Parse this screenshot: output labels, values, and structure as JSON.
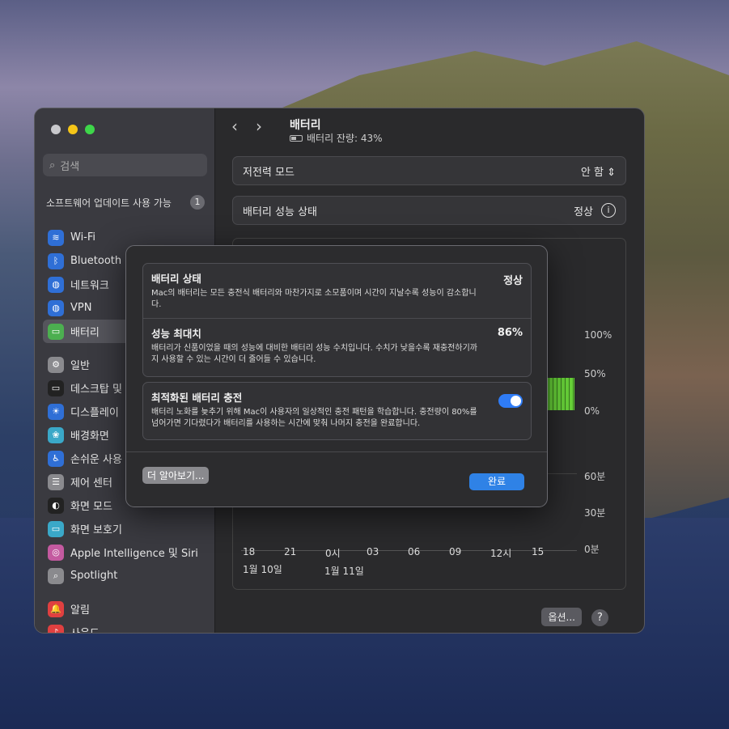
{
  "window": {
    "title": "배터리",
    "subtitle": "배터리 잔량: 43%",
    "battery_level_percent": 43
  },
  "sidebar": {
    "search_placeholder": "검색",
    "update_label": "소프트웨어 업데이트 사용 가능",
    "update_count": "1",
    "items": [
      {
        "label": "Wi-Fi",
        "icon": "wifi-icon",
        "color": "#2f6fd6",
        "glyph": "≋"
      },
      {
        "label": "Bluetooth",
        "icon": "bluetooth-icon",
        "color": "#2f6fd6",
        "glyph": "ᛒ"
      },
      {
        "label": "네트워크",
        "icon": "globe-icon",
        "color": "#2f6fd6",
        "glyph": "◍"
      },
      {
        "label": "VPN",
        "icon": "vpn-globe-icon",
        "color": "#2f6fd6",
        "glyph": "◍"
      },
      {
        "label": "배터리",
        "icon": "battery-icon",
        "color": "#4caf50",
        "glyph": "▭",
        "selected": true
      },
      {
        "label": "일반",
        "icon": "gear-icon",
        "color": "#8a8a8e",
        "glyph": "⚙"
      },
      {
        "label": "데스크탑 및 Dock",
        "icon": "dock-icon",
        "color": "#222",
        "glyph": "▭"
      },
      {
        "label": "디스플레이",
        "icon": "display-icon",
        "color": "#2f6fd6",
        "glyph": "☀"
      },
      {
        "label": "배경화면",
        "icon": "wallpaper-icon",
        "color": "#3aa8c8",
        "glyph": "❀"
      },
      {
        "label": "손쉬운 사용",
        "icon": "accessibility-icon",
        "color": "#2f6fd6",
        "glyph": "♿"
      },
      {
        "label": "제어 센터",
        "icon": "control-center-icon",
        "color": "#8a8a8e",
        "glyph": "☰"
      },
      {
        "label": "화면 모드",
        "icon": "appearance-icon",
        "color": "#222",
        "glyph": "◐"
      },
      {
        "label": "화면 보호기",
        "icon": "screensaver-icon",
        "color": "#3aa8c8",
        "glyph": "▭"
      },
      {
        "label": "Apple Intelligence 및 Siri",
        "icon": "siri-icon",
        "color": "#c45aa0",
        "glyph": "◎"
      },
      {
        "label": "Spotlight",
        "icon": "spotlight-icon",
        "color": "#8a8a8e",
        "glyph": "⌕"
      },
      {
        "label": "알림",
        "icon": "bell-icon",
        "color": "#e04040",
        "glyph": "🔔"
      },
      {
        "label": "사운드",
        "icon": "sound-icon",
        "color": "#e04040",
        "glyph": "♪"
      }
    ]
  },
  "main": {
    "low_power_label": "저전력 모드",
    "low_power_value": "안 함",
    "health_label": "배터리 성능 상태",
    "health_value": "정상",
    "level_axis": [
      "100%",
      "50%",
      "0%"
    ],
    "usage_axis": [
      "60분",
      "30분",
      "0분"
    ],
    "x_ticks": [
      "18",
      "21",
      "0시",
      "03",
      "06",
      "09",
      "12시",
      "15"
    ],
    "dates": [
      "1월 10일",
      "1월 11일"
    ],
    "options_label": "옵션...",
    "help_label": "?"
  },
  "dialog": {
    "status_title": "배터리 상태",
    "status_value": "정상",
    "status_desc": "Mac의 배터리는 모든 충전식 배터리와 마찬가지로 소모품이며 시간이 지날수록 성능이 감소합니다.",
    "capacity_title": "성능 최대치",
    "capacity_value": "86%",
    "capacity_desc": "배터리가 신품이었을 때의 성능에 대비한 배터리 성능 수치입니다. 수치가 낮을수록 재충전하기까지 사용할 수 있는 시간이 더 줄어들 수 있습니다.",
    "optimized_title": "최적화된 배터리 충전",
    "optimized_enabled": true,
    "optimized_desc": "배터리 노화를 늦추기 위해 Mac이 사용자의 일상적인 충전 패턴을 학습합니다. 충전량이 80%를 넘어가면 기다렸다가 배터리를 사용하는 시간에 맞춰 나머지 충전을 완료합니다.",
    "learn_more_label": "더 알아보기...",
    "done_label": "완료"
  },
  "colors": {
    "accent": "#2f82e6",
    "battery_green": "#6ad83a"
  }
}
